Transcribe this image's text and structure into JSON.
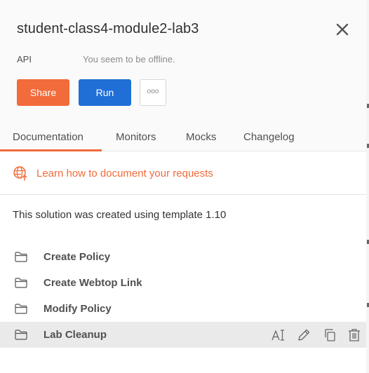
{
  "collection": {
    "title": "student-class4-module2-lab3",
    "type_label": "API",
    "status_text": "You seem to be offline."
  },
  "actions": {
    "share_label": "Share",
    "run_label": "Run",
    "more_label": "ooo"
  },
  "tabs": [
    {
      "label": "Documentation",
      "active": true
    },
    {
      "label": "Monitors",
      "active": false
    },
    {
      "label": "Mocks",
      "active": false
    },
    {
      "label": "Changelog",
      "active": false
    }
  ],
  "learn_link": {
    "text": "Learn how to document your requests",
    "icon": "globe-icon"
  },
  "description": "This solution was created using template 1.10",
  "folders": [
    {
      "name": "Create Policy",
      "icon": "folder-icon",
      "hovered": false
    },
    {
      "name": "Create Webtop Link",
      "icon": "folder-icon",
      "hovered": false
    },
    {
      "name": "Modify Policy",
      "icon": "folder-icon",
      "hovered": false
    },
    {
      "name": "Lab Cleanup",
      "icon": "folder-icon",
      "hovered": true
    }
  ],
  "row_action_icons": [
    "rename-icon",
    "edit-icon",
    "duplicate-icon",
    "delete-icon"
  ],
  "colors": {
    "accent": "#f26b3a",
    "primary": "#1f6fd6",
    "header_bg": "#fafafa",
    "hover_bg": "#eaeaea"
  }
}
